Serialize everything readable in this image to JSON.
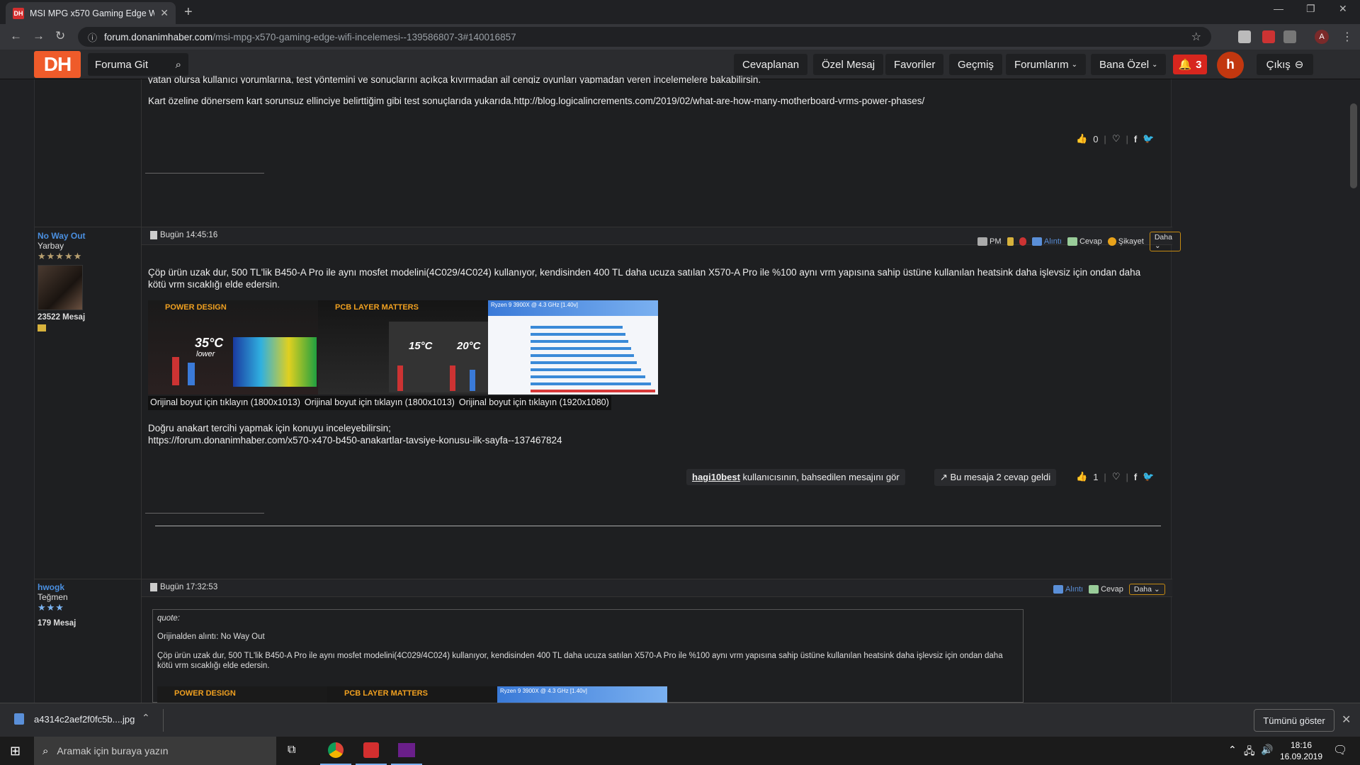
{
  "browser": {
    "tab_title": "MSI MPG x570 Gaming Edge Wifi",
    "tab_favicon": "DH",
    "url_domain": "forum.donanimhaber.com",
    "url_path": "/msi-mpg-x570-gaming-edge-wifi-incelemesi--139586807-3#140016857",
    "profile_initial": "A"
  },
  "site": {
    "logo": "DH",
    "search_label": "Foruma Git",
    "menu": [
      "Cevaplanan",
      "Özel Mesaj",
      "Favoriler",
      "Geçmiş",
      "Forumlarım",
      "Bana Özel"
    ],
    "notif_count": "3",
    "user_initial": "h",
    "logout": "Çıkış"
  },
  "post0": {
    "partial_line": "yatan olursa kullanıcı yorumlarına, test yöntemini ve sonuçlarını açıkça kıvırmadan ail cengiz oyunları yapmadan veren incelemelere bakabilirsin.",
    "line": "Kart özeline dönersem kart sorunsuz ellinciye belirttiğim gibi test sonuçlarıda yukarıda.http://blog.logicalincrements.com/2019/02/what-are-how-many-motherboard-vrms-power-phases/",
    "likes": "0"
  },
  "post1": {
    "username": "No Way Out",
    "rank": "Yarbay",
    "stars": "★★★★★",
    "messages": "23522 Mesaj",
    "date": "Bugün 14:45:16",
    "actions": {
      "pm": "PM",
      "quote": "Alıntı",
      "reply": "Cevap",
      "report": "Şikayet",
      "more": "Daha"
    },
    "body": "Çöp ürün uzak dur, 500 TL'lik B450-A Pro ile aynı mosfet modelini(4C029/4C024) kullanıyor, kendisinden 400 TL daha ucuza satılan X570-A Pro ile %100 aynı vrm yapısına sahip üstüne kullanılan heatsink daha işlevsiz için ondan daha kötü vrm sıcaklığı elde edersin.",
    "images": [
      {
        "title": "POWER DESIGN",
        "big": "35°C",
        "sub": "lower",
        "caption": "Orijinal boyut için tıklayın (1800x1013)"
      },
      {
        "title": "PCB LAYER MATTERS",
        "big": "15°C",
        "sub": "20°C",
        "caption": "Orijinal boyut için tıklayın (1800x1013)"
      },
      {
        "title": "Ryzen 9 3900X @ 4.3 GHz [1.40v]",
        "big": "",
        "sub": "",
        "caption": "Orijinal boyut için tıklayın (1920x1080)"
      }
    ],
    "link_text": "Doğru anakart tercihi yapmak için konuyu inceleyebilirsin;",
    "link_url": "https://forum.donanimhaber.com/x570-x470-b450-anakartlar-tavsiye-konusu-ilk-sayfa--137467824",
    "ref_user": "hagi10best",
    "ref_text": " kullanıcısının, bahsedilen mesajını gör",
    "replies": "Bu mesaja 2 cevap geldi",
    "likes": "1"
  },
  "post2": {
    "username": "hwogk",
    "rank": "Teğmen",
    "stars": "★★★",
    "messages": "179 Mesaj",
    "date": "Bugün 17:32:53",
    "actions": {
      "quote": "Alıntı",
      "reply": "Cevap",
      "more": "Daha"
    },
    "quote_label": "quote:",
    "quote_from": "Orijinalden alıntı: No Way Out",
    "quote_body": "Çöp ürün uzak dur, 500 TL'lik B450-A Pro ile aynı mosfet modelini(4C029/4C024) kullanıyor, kendisinden 400 TL daha ucuza satılan X570-A Pro ile %100 aynı vrm yapısına sahip üstüne kullanılan heatsink daha işlevsiz için ondan daha kötü vrm sıcaklığı elde edersin."
  },
  "download": {
    "file": "a4314c2aef2f0fc5b....jpg",
    "show_all": "Tümünü göster"
  },
  "taskbar": {
    "search": "Aramak için buraya yazın",
    "time": "18:16",
    "date": "16.09.2019"
  },
  "colors": {
    "accent": "#ef5b2a",
    "link": "#4a8fe0",
    "bell": "#d7261e"
  }
}
